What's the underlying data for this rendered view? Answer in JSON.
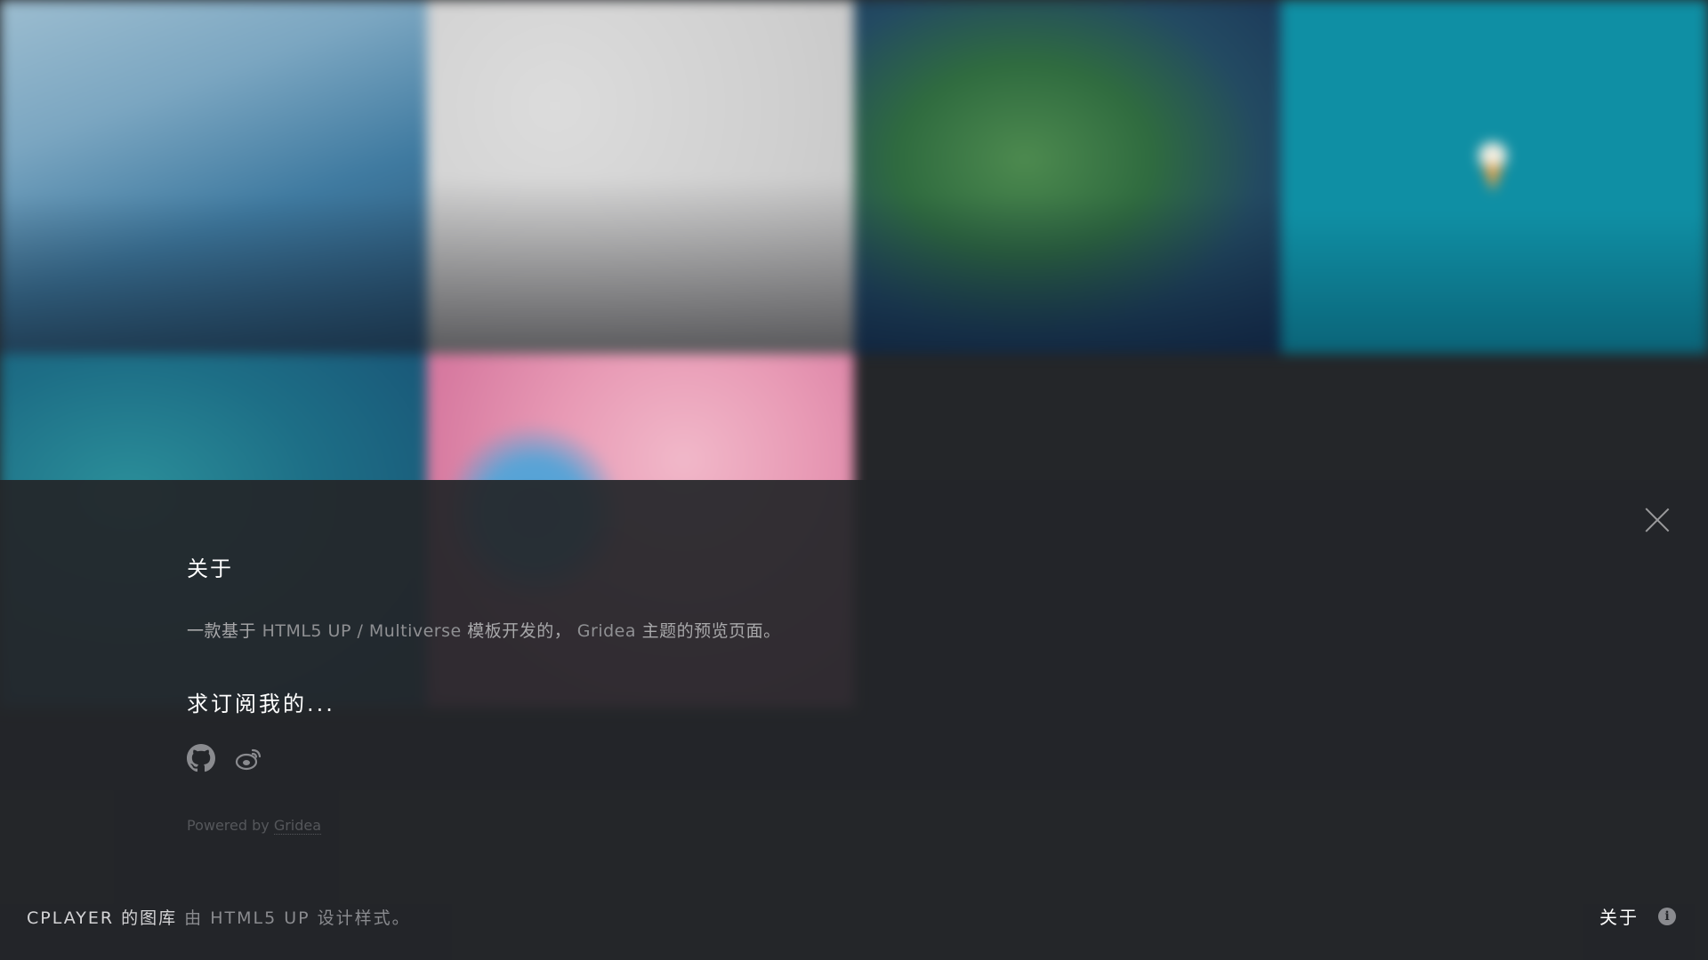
{
  "overlay": {
    "about_heading": "关于",
    "about_text_prefix": "一款基于",
    "about_text_template": "HTML5 UP / Multiverse",
    "about_text_middle": "模板开发的，",
    "about_text_gridea": "Gridea",
    "about_text_suffix": "主题的预览页面。",
    "subscribe_heading": "求订阅我的...",
    "social": [
      {
        "icon": "github-icon"
      },
      {
        "icon": "weibo-icon"
      }
    ],
    "powered_prefix": "Powered by",
    "powered_link": "Gridea"
  },
  "footer": {
    "site_name": "CPLAYER 的图库",
    "by": "由",
    "designer": "HTML5 UP",
    "suffix": "设计样式。",
    "about_label": "关于"
  },
  "colors": {
    "background": "#242629",
    "heading": "#ffffff",
    "body_text": "#a8a8aa"
  }
}
